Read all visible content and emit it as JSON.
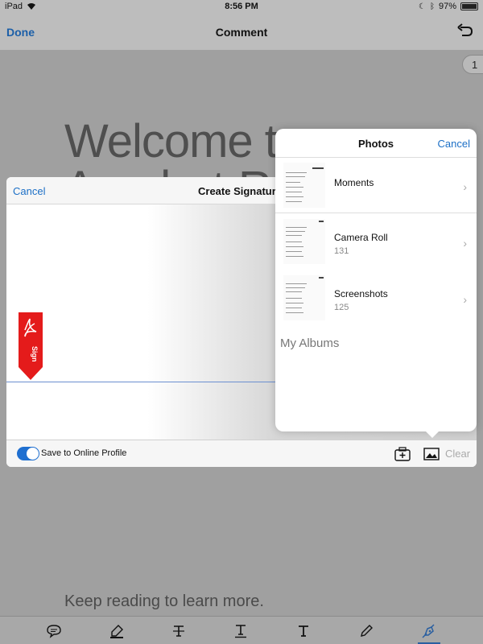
{
  "status_bar": {
    "device": "iPad",
    "time": "8:56 PM",
    "battery": "97%"
  },
  "nav": {
    "done": "Done",
    "title": "Comment",
    "page_number": "1"
  },
  "document": {
    "line1": "Welcome to",
    "line2": "Acrobat Reader",
    "bottom_text": "Keep reading to learn more."
  },
  "signature": {
    "cancel": "Cancel",
    "title": "Create Signature",
    "flag_text": "Sign",
    "save_label": "Save to Online Profile",
    "save_enabled": true,
    "clear": "Clear"
  },
  "photos": {
    "title": "Photos",
    "cancel": "Cancel",
    "albums": [
      {
        "name": "Moments",
        "count": ""
      },
      {
        "name": "Camera Roll",
        "count": "131"
      },
      {
        "name": "Screenshots",
        "count": "125"
      }
    ],
    "my_albums": "My Albums"
  },
  "toolbar": {
    "tools": [
      "comment-icon",
      "highlighter-icon",
      "strikethrough-icon",
      "underline-icon",
      "text-icon",
      "pencil-icon",
      "signature-pen-icon"
    ],
    "active": "signature-pen-icon"
  },
  "colors": {
    "accent": "#1c6fc6",
    "flag": "#e41b1b"
  }
}
